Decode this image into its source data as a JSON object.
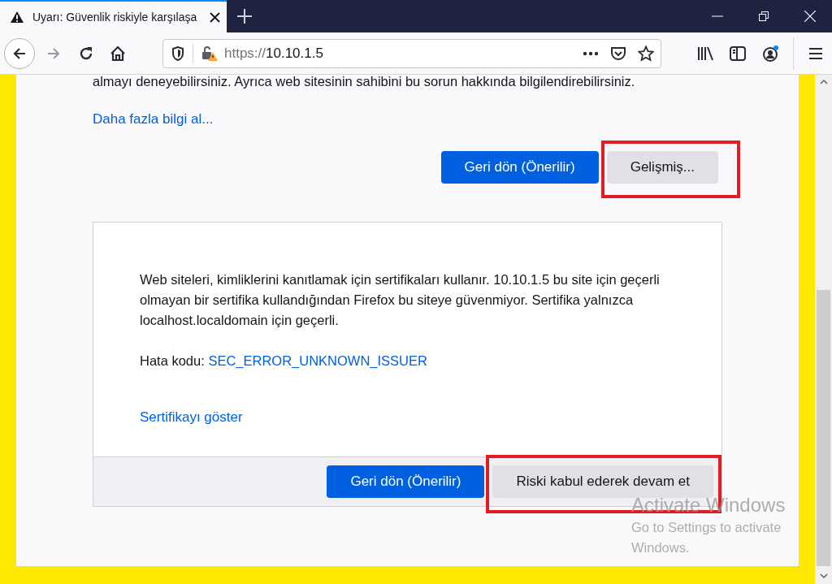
{
  "tabs": [
    {
      "title": "Uyarı: Güvenlik riskiyle karşılaşa",
      "selected": true
    }
  ],
  "address_bar": {
    "scheme": "https://",
    "host": "10.10.1.5"
  },
  "page": {
    "intro_tail": "almayı deneyebilirsiniz. Ayrıca web sitesinin sahibini bu sorun hakkında bilgilendirebilirsiniz.",
    "learn_more": "Daha fazla bilgi al...",
    "buttons": [
      {
        "label": "Geri dön (Önerilir)",
        "kind": "primary"
      },
      {
        "label": "Gelişmiş...",
        "kind": "secondary",
        "highlighted": true
      }
    ],
    "advanced": {
      "text": "Web siteleri, kimliklerini kanıtlamak için sertifikaları kullanır. 10.10.1.5 bu site için geçerli olmayan bir sertifika kullandığından Firefox bu siteye güvenmiyor. Sertifika yalnızca localhost.localdomain için geçerli.",
      "error_label": "Hata kodu:",
      "error_code": "SEC_ERROR_UNKNOWN_ISSUER",
      "view_certificate": "Sertifikayı göster",
      "buttons": [
        {
          "label": "Geri dön (Önerilir)",
          "kind": "primary"
        },
        {
          "label": "Riski kabul ederek devam et",
          "kind": "secondary",
          "highlighted": true
        }
      ]
    }
  },
  "os_notice": {
    "title": "Activate Windows",
    "text": "Go to Settings to activate\nWindows."
  }
}
